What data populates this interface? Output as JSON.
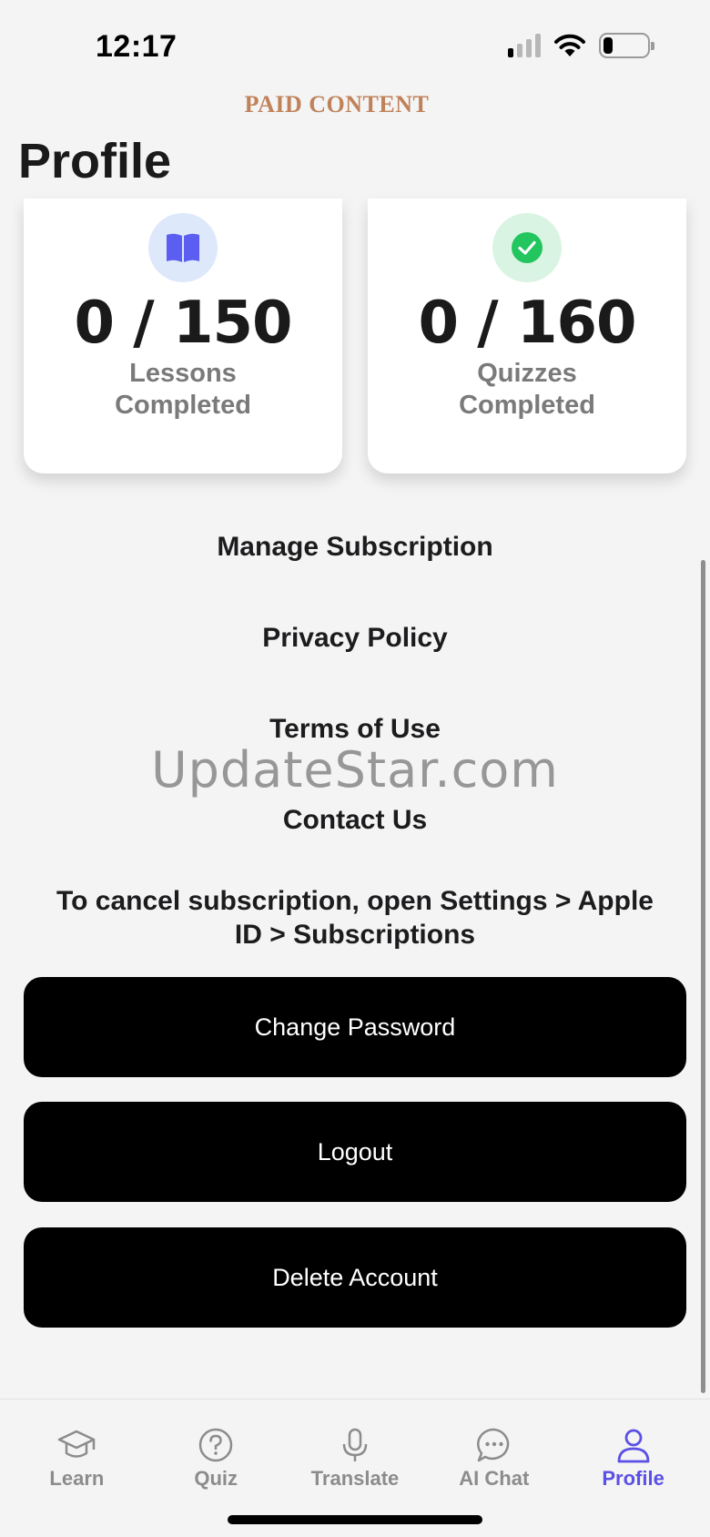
{
  "status": {
    "time": "12:17"
  },
  "banner": "PAID CONTENT",
  "page_title": "Profile",
  "stats": [
    {
      "value": "0 / 150",
      "label": "Lessons Completed",
      "icon": "book-icon",
      "icon_color": "#5b5ef0",
      "icon_bg": "#dde8fb"
    },
    {
      "value": "0 / 160",
      "label": "Quizzes Completed",
      "icon": "check-circle-icon",
      "icon_color": "#22c55e",
      "icon_bg": "#d9f4e2"
    }
  ],
  "links": {
    "manage_subscription": "Manage Subscription",
    "privacy_policy": "Privacy Policy",
    "terms_of_use": "Terms of Use",
    "contact_us": "Contact Us"
  },
  "watermark": "UpdateStar.com",
  "cancel_note": "To cancel subscription, open Settings > Apple ID > Subscriptions",
  "buttons": {
    "change_password": "Change Password",
    "logout": "Logout",
    "delete_account": "Delete Account"
  },
  "tabs": [
    {
      "label": "Learn",
      "icon": "graduation-cap-icon",
      "active": false
    },
    {
      "label": "Quiz",
      "icon": "question-circle-icon",
      "active": false
    },
    {
      "label": "Translate",
      "icon": "microphone-icon",
      "active": false
    },
    {
      "label": "AI Chat",
      "icon": "chat-bubble-icon",
      "active": false
    },
    {
      "label": "Profile",
      "icon": "person-icon",
      "active": true
    }
  ],
  "colors": {
    "accent": "#5b50e6",
    "tab_inactive": "#8c8c8c",
    "button_bg": "#000000",
    "banner": "#c0825a"
  }
}
